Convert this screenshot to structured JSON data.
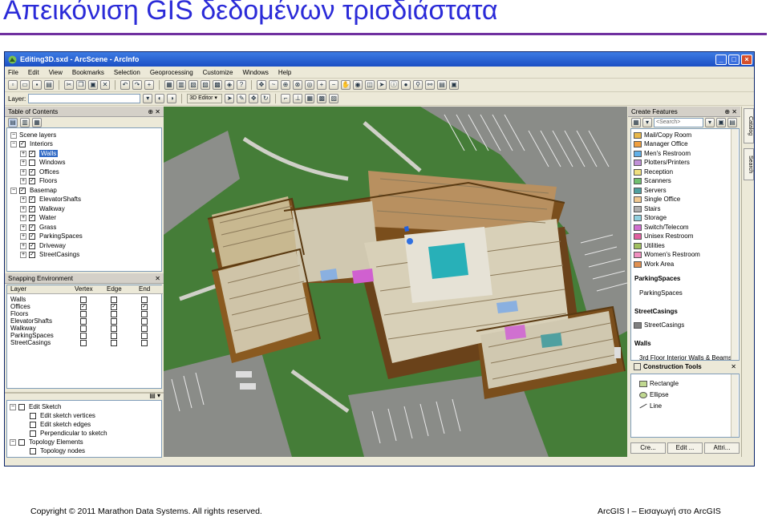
{
  "slide": {
    "title": "Απεικόνιση GIS δεδομένων τρισδιάστατα",
    "footer_left": "Copyright © 2011 Marathon Data Systems.  All rights reserved.",
    "footer_right": "ArcGIS I – Εισαγωγή στο ArcGIS"
  },
  "window": {
    "title": "Editing3D.sxd - ArcScene - ArcInfo",
    "menu": [
      "File",
      "Edit",
      "View",
      "Bookmarks",
      "Selection",
      "Geoprocessing",
      "Customize",
      "Windows",
      "Help"
    ],
    "toolbar2": {
      "layer_label": "Layer:",
      "editor_label": "3D Editor ▾"
    }
  },
  "toc": {
    "header": "Table of Contents",
    "items": [
      {
        "label": "Scene layers",
        "level": 0,
        "checked": null
      },
      {
        "label": "Interiors",
        "level": 0,
        "checked": true
      },
      {
        "label": "Walls",
        "level": 1,
        "checked": true
      },
      {
        "label": "Windows",
        "level": 1,
        "checked": false
      },
      {
        "label": "Offices",
        "level": 1,
        "checked": true
      },
      {
        "label": "Floors",
        "level": 1,
        "checked": true
      },
      {
        "label": "Basemap",
        "level": 0,
        "checked": true
      },
      {
        "label": "ElevatorShafts",
        "level": 1,
        "checked": true
      },
      {
        "label": "Walkway",
        "level": 1,
        "checked": true
      },
      {
        "label": "Water",
        "level": 1,
        "checked": true
      },
      {
        "label": "Grass",
        "level": 1,
        "checked": true
      },
      {
        "label": "ParkingSpaces",
        "level": 1,
        "checked": true
      },
      {
        "label": "Driveway",
        "level": 1,
        "checked": true
      },
      {
        "label": "StreetCasings",
        "level": 1,
        "checked": true
      }
    ]
  },
  "snapping": {
    "header": "Snapping Environment",
    "columns": [
      "Layer",
      "Vertex",
      "Edge",
      "End"
    ],
    "rows": [
      {
        "layer": "Walls",
        "vertex": false,
        "edge": false,
        "end": false
      },
      {
        "layer": "Offices",
        "vertex": true,
        "edge": true,
        "end": true
      },
      {
        "layer": "Floors",
        "vertex": false,
        "edge": false,
        "end": false
      },
      {
        "layer": "ElevatorShafts",
        "vertex": false,
        "edge": false,
        "end": false
      },
      {
        "layer": "Walkway",
        "vertex": false,
        "edge": false,
        "end": false
      },
      {
        "layer": "ParkingSpaces",
        "vertex": false,
        "edge": false,
        "end": false
      },
      {
        "layer": "StreetCasings",
        "vertex": false,
        "edge": false,
        "end": false
      }
    ]
  },
  "sketch": {
    "items": [
      {
        "label": "Edit Sketch",
        "level": 0
      },
      {
        "label": "Edit sketch vertices",
        "level": 1
      },
      {
        "label": "Edit sketch edges",
        "level": 1
      },
      {
        "label": "Perpendicular to sketch",
        "level": 1
      },
      {
        "label": "Topology Elements",
        "level": 0
      },
      {
        "label": "Topology nodes",
        "level": 1
      }
    ]
  },
  "create_features": {
    "header": "Create Features",
    "search_placeholder": "<Search>",
    "features": [
      {
        "label": "Mail/Copy Room",
        "color": "#e8b84a"
      },
      {
        "label": "Manager Office",
        "color": "#f0a040"
      },
      {
        "label": "Men's Restroom",
        "color": "#60b0e8"
      },
      {
        "label": "Plotters/Printers",
        "color": "#c090d8"
      },
      {
        "label": "Reception",
        "color": "#f0e080"
      },
      {
        "label": "Scanners",
        "color": "#70c070"
      },
      {
        "label": "Servers",
        "color": "#50a0a0"
      },
      {
        "label": "Single Office",
        "color": "#f0c890"
      },
      {
        "label": "Stairs",
        "color": "#b0b0b0"
      },
      {
        "label": "Storage",
        "color": "#90d0e0"
      },
      {
        "label": "Switch/Telecom",
        "color": "#d070d0"
      },
      {
        "label": "Unisex Restroom",
        "color": "#e060a0"
      },
      {
        "label": "Utilities",
        "color": "#a0c060"
      },
      {
        "label": "Women's Restroom",
        "color": "#f090c0"
      },
      {
        "label": "Work Area",
        "color": "#e09050"
      }
    ],
    "groups": [
      {
        "name": "ParkingSpaces",
        "item": "ParkingSpaces",
        "color": ""
      },
      {
        "name": "StreetCasings",
        "item": "StreetCasings",
        "color": "#808080"
      },
      {
        "name": "Walls",
        "item": "3rd Floor Interior Walls & Beams",
        "color": "#c08a40"
      }
    ]
  },
  "construction": {
    "header": "Construction Tools",
    "tools": [
      "Rectangle",
      "Ellipse",
      "Line"
    ]
  },
  "bottom_tabs": [
    "Cre...",
    "Edit ...",
    "Attri..."
  ],
  "side_tabs": [
    "Catalog",
    "Search"
  ]
}
